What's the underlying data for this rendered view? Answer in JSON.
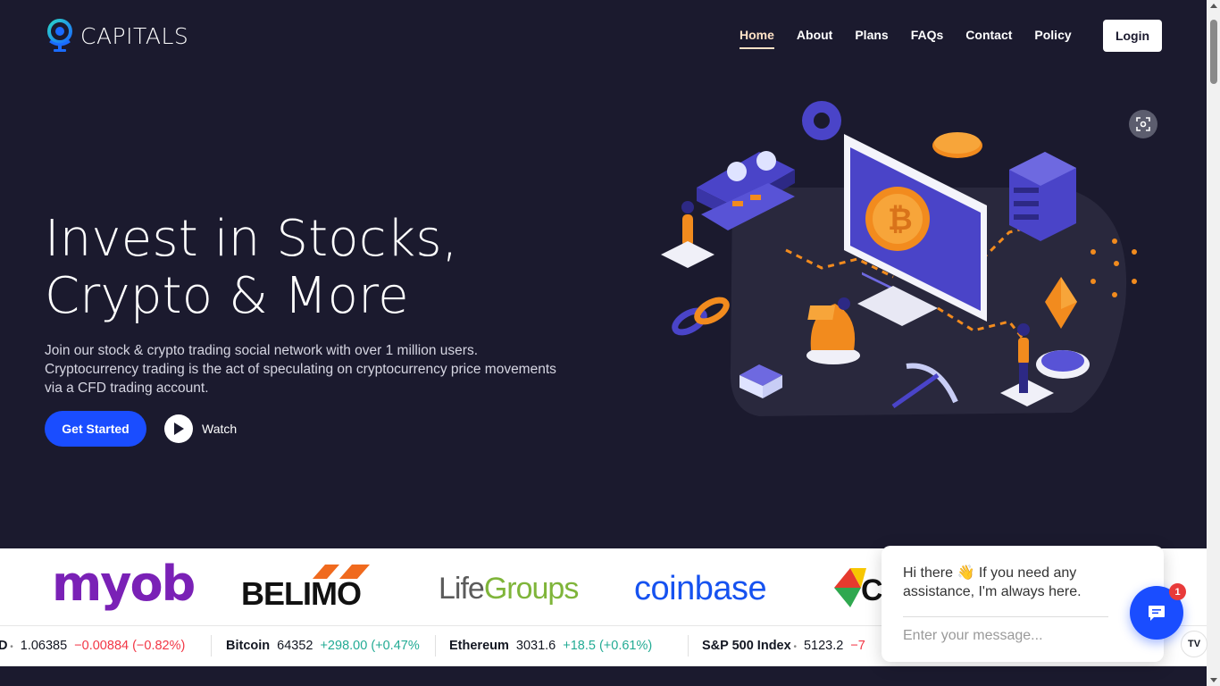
{
  "brand": {
    "name": "CAPITALS",
    "logo_icon": "globe-icon",
    "accent": "#1a4dff",
    "background": "#1b1a2e"
  },
  "nav": {
    "items": [
      {
        "label": "Home",
        "active": true
      },
      {
        "label": "About",
        "active": false
      },
      {
        "label": "Plans",
        "active": false
      },
      {
        "label": "FAQs",
        "active": false
      },
      {
        "label": "Contact",
        "active": false
      },
      {
        "label": "Policy",
        "active": false
      }
    ],
    "login_label": "Login"
  },
  "hero": {
    "headline_line1": "Invest in Stocks,",
    "headline_line2": "Crypto & More",
    "subtext_line1": "Join our stock & crypto trading social network with over 1 million users.",
    "subtext_line2": "Cryptocurrency trading is the act of speculating on cryptocurrency price movements",
    "subtext_line3": "via a CFD trading account.",
    "cta_label": "Get Started",
    "watch_label": "Watch",
    "illustration": "crypto-trading-isometric-illustration"
  },
  "partners": {
    "myob": "myob",
    "belimo": "BELIMO",
    "lifegroups_a": "Life",
    "lifegroups_b": "Groups",
    "coinbase": "coinbase"
  },
  "ticker": {
    "items": [
      {
        "name": "D",
        "price": "1.06385",
        "change": "−0.00884 (−0.82%)",
        "direction": "down"
      },
      {
        "name": "Bitcoin",
        "price": "64352",
        "change": "+298.00 (+0.47%",
        "direction": "up"
      },
      {
        "name": "Ethereum",
        "price": "3031.6",
        "change": "+18.5 (+0.61%)",
        "direction": "up"
      },
      {
        "name": "S&P 500 Index",
        "price": "5123.2",
        "change": "−7",
        "direction": "down"
      }
    ],
    "brand_badge": "TV"
  },
  "chat": {
    "greeting": "Hi there 👋 If you need any assistance, I'm always here.",
    "input_placeholder": "Enter your message...",
    "unread_count": "1"
  }
}
